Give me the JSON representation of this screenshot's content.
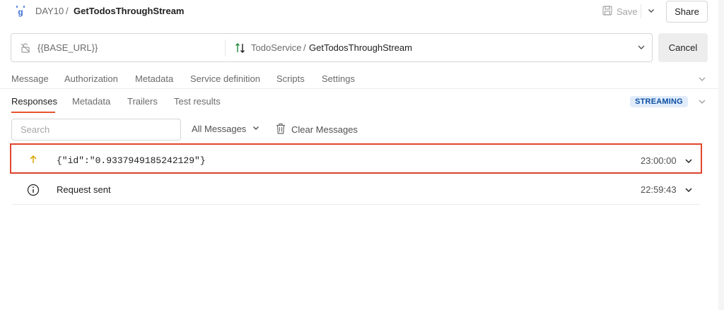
{
  "header": {
    "breadcrumb_parent": "DAY10",
    "breadcrumb_sep": "/",
    "title": "GetTodosThroughStream",
    "save_label": "Save",
    "share_label": "Share"
  },
  "urlbar": {
    "url": "{{BASE_URL}}",
    "service": "TodoService",
    "method_sep": "/",
    "method": "GetTodosThroughStream",
    "cancel_label": "Cancel"
  },
  "request_tabs": [
    "Message",
    "Authorization",
    "Metadata",
    "Service definition",
    "Scripts",
    "Settings"
  ],
  "response_tabs": [
    "Responses",
    "Metadata",
    "Trailers",
    "Test results"
  ],
  "status_badge": "STREAMING",
  "search": {
    "placeholder": "Search"
  },
  "filter": {
    "selected": "All Messages"
  },
  "clear_label": "Clear Messages",
  "messages": [
    {
      "direction": "incoming",
      "icon": "arrow-up-icon",
      "text": "{\"id\":\"0.9337949185242129\"}",
      "time": "23:00:00"
    },
    {
      "direction": "info",
      "icon": "info-icon",
      "text": "Request sent",
      "time": "22:59:43"
    }
  ],
  "colors": {
    "accent": "#e8542e",
    "highlight_border": "#e0462e",
    "badge_bg": "#e1ecfb",
    "badge_text": "#0c4ea3",
    "grpc_blue": "#3b6fd8",
    "method_green": "#1f8a3a",
    "incoming_arrow": "#d9a400"
  }
}
